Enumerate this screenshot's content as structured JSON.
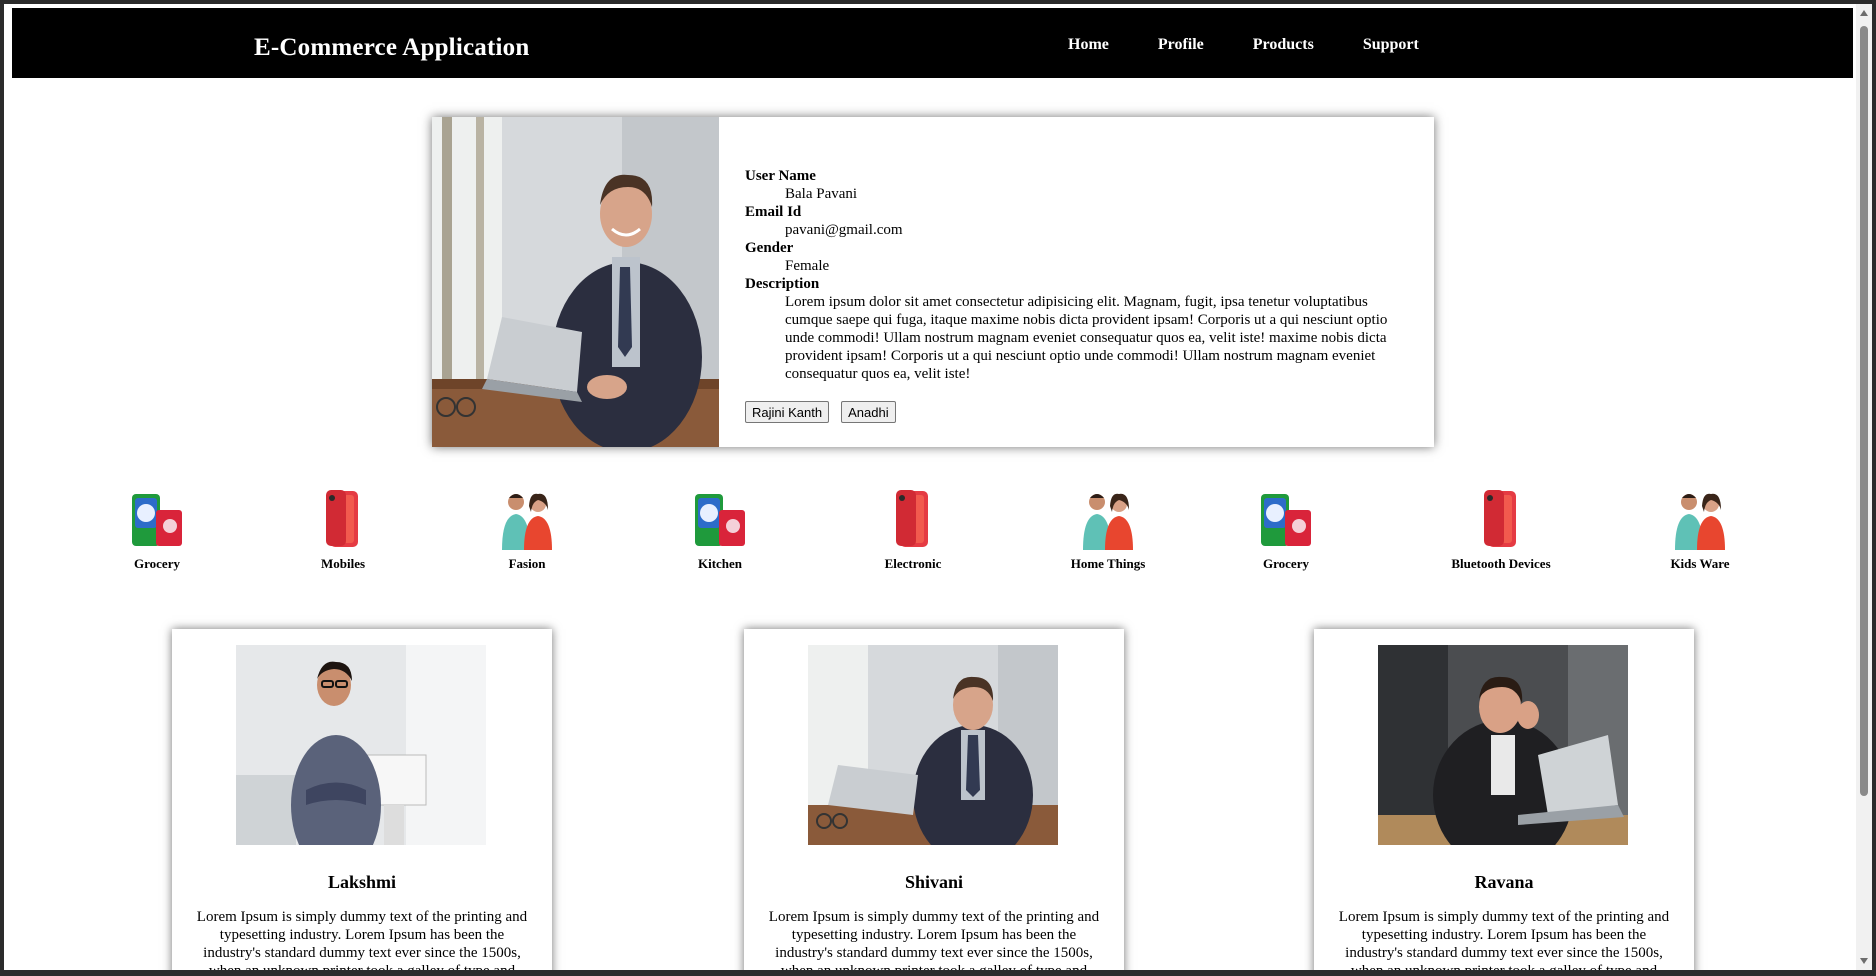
{
  "header": {
    "title": "E-Commerce Application",
    "nav": [
      "Home",
      "Profile",
      "Products",
      "Support"
    ]
  },
  "profile": {
    "user_name_label": "User Name",
    "user_name": "Bala Pavani",
    "email_label": "Email Id",
    "email": "pavani@gmail.com",
    "gender_label": "Gender",
    "gender": "Female",
    "description_label": "Description",
    "description": "Lorem ipsum dolor sit amet consectetur adipisicing elit. Magnam, fugit, ipsa tenetur voluptatibus cumque saepe qui fuga, itaque maxime nobis dicta provident ipsam! Corporis ut a qui nesciunt optio unde commodi! Ullam nostrum magnam eveniet consequatur quos ea, velit iste! maxime nobis dicta provident ipsam! Corporis ut a qui nesciunt optio unde commodi! Ullam nostrum magnam eveniet consequatur quos ea, velit iste!",
    "buttons": [
      "Rajini Kanth",
      "Anadhi"
    ]
  },
  "categories": [
    {
      "label": "Grocery",
      "icon": "detergent-box-icon"
    },
    {
      "label": "Mobiles",
      "icon": "phone-icon"
    },
    {
      "label": "Fasion",
      "icon": "couple-icon"
    },
    {
      "label": "Kitchen",
      "icon": "detergent-box-icon"
    },
    {
      "label": "Electronic",
      "icon": "phone-icon"
    },
    {
      "label": "Home Things",
      "icon": "couple-icon"
    },
    {
      "label": "Grocery",
      "icon": "detergent-box-icon"
    },
    {
      "label": "Bluetooth Devices",
      "icon": "phone-icon"
    },
    {
      "label": "Kids Ware",
      "icon": "couple-icon"
    }
  ],
  "people": [
    {
      "name": "Lakshmi",
      "description": "Lorem Ipsum is simply dummy text of the printing and typesetting industry. Lorem Ipsum has been the industry's standard dummy text ever since the 1500s, when an unknown printer took a galley of type and"
    },
    {
      "name": "Shivani",
      "description": "Lorem Ipsum is simply dummy text of the printing and typesetting industry. Lorem Ipsum has been the industry's standard dummy text ever since the 1500s, when an unknown printer took a galley of type and"
    },
    {
      "name": "Ravana",
      "description": "Lorem Ipsum is simply dummy text of the printing and typesetting industry. Lorem Ipsum has been the industry's standard dummy text ever since the 1500s, when an unknown printer took a galley of type and"
    }
  ],
  "colors": {
    "navbar": "#000000",
    "page": "#ffffff"
  }
}
